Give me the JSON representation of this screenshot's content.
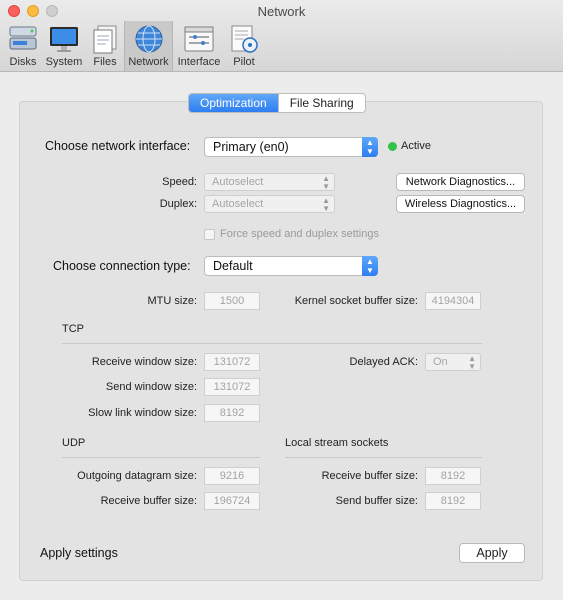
{
  "window": {
    "title": "Network"
  },
  "toolbar": {
    "items": [
      {
        "label": "Disks",
        "icon": "disks-icon"
      },
      {
        "label": "System",
        "icon": "monitor-icon"
      },
      {
        "label": "Files",
        "icon": "files-icon"
      },
      {
        "label": "Network",
        "icon": "network-globe-icon"
      },
      {
        "label": "Interface",
        "icon": "interface-window-icon"
      },
      {
        "label": "Pilot",
        "icon": "pilot-icon"
      }
    ],
    "selected": "Network"
  },
  "tabs": [
    {
      "label": "Optimization",
      "active": true
    },
    {
      "label": "File Sharing",
      "active": false
    }
  ],
  "interface": {
    "label": "Choose network interface:",
    "value": "Primary (en0)",
    "status": "Active",
    "status_color": "#33c24a"
  },
  "speed": {
    "label": "Speed:",
    "value": "Autoselect"
  },
  "duplex": {
    "label": "Duplex:",
    "value": "Autoselect"
  },
  "diagnostics": {
    "network_label": "Network Diagnostics...",
    "wireless_label": "Wireless Diagnostics..."
  },
  "force_label": "Force speed and duplex settings",
  "connection": {
    "label": "Choose connection type:",
    "value": "Default"
  },
  "mtu": {
    "label": "MTU size:",
    "value": "1500"
  },
  "kernel": {
    "label": "Kernel socket buffer size:",
    "value": "4194304"
  },
  "tcp": {
    "heading": "TCP",
    "receive_window": {
      "label": "Receive window size:",
      "value": "131072"
    },
    "send_window": {
      "label": "Send window size:",
      "value": "131072"
    },
    "slow_link": {
      "label": "Slow link window size:",
      "value": "8192"
    },
    "delayed_ack": {
      "label": "Delayed ACK:",
      "value": "On"
    }
  },
  "udp": {
    "heading": "UDP",
    "outgoing": {
      "label": "Outgoing datagram size:",
      "value": "9216"
    },
    "receive": {
      "label": "Receive buffer size:",
      "value": "196724"
    }
  },
  "local": {
    "heading": "Local stream sockets",
    "receive": {
      "label": "Receive buffer size:",
      "value": "8192"
    },
    "send": {
      "label": "Send buffer size:",
      "value": "8192"
    }
  },
  "footer": {
    "label": "Apply settings",
    "button": "Apply"
  },
  "colors": {
    "accent": "#2e7ef0",
    "background": "#ececec"
  }
}
